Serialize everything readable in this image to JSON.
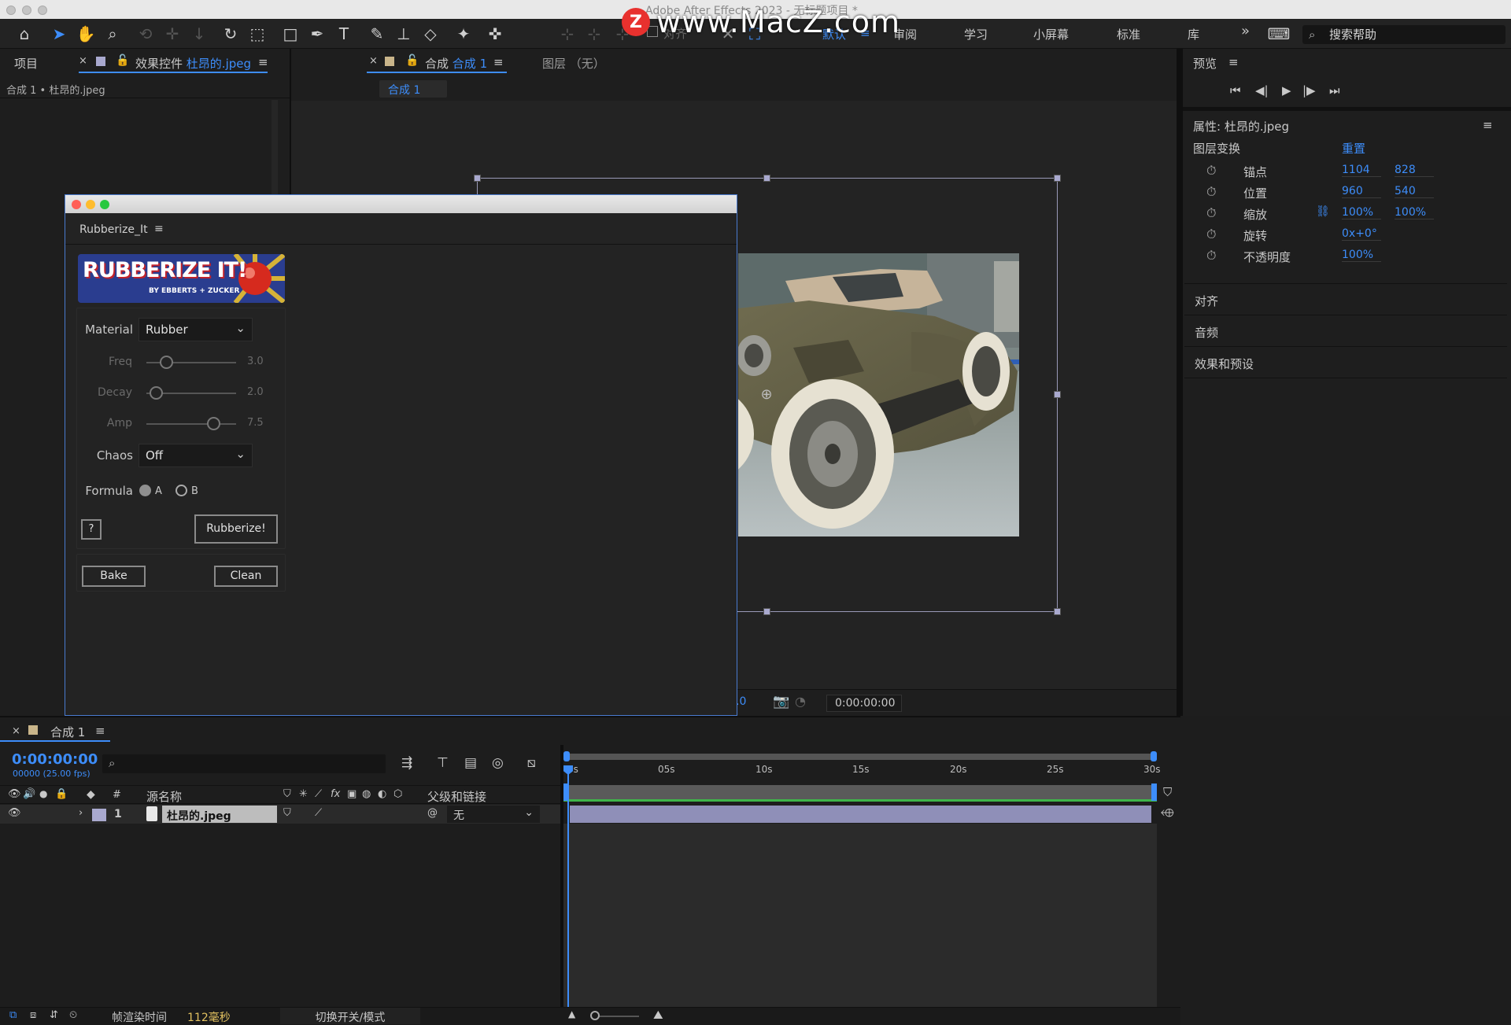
{
  "window": {
    "title": "Adobe After Effects 2023 - 无标题项目 *"
  },
  "watermark": {
    "logo": "Z",
    "text": "www.MacZ.com"
  },
  "toolbar": {
    "align_label": "对齐",
    "workspaces": [
      "默认",
      "审阅",
      "学习",
      "小屏幕",
      "标准",
      "库"
    ],
    "more_label": "»",
    "search_placeholder": "搜索帮助"
  },
  "left_panel": {
    "tab_project": "项目",
    "tab_effects_prefix": "效果控件",
    "tab_effects_layer": "杜昂的.jpeg",
    "breadcrumb": "合成 1 • 杜昂的.jpeg"
  },
  "comp_panel": {
    "tab_prefix": "合成",
    "tab_name": "合成 1",
    "tab_layer": "图层 （无）",
    "subtab": "合成 1",
    "footer_zoom": ".0",
    "footer_time": "0:00:00:00"
  },
  "plugin": {
    "panel_title": "Rubberize_It",
    "logo_main": "RUBBERIZE IT!",
    "logo_sub": "BY EBBERTS + ZUCKER",
    "material_label": "Material",
    "material_value": "Rubber",
    "sliders": [
      {
        "label": "Freq",
        "value": "3.0",
        "fraction": 0.3
      },
      {
        "label": "Decay",
        "value": "2.0",
        "fraction": 0.18
      },
      {
        "label": "Amp",
        "value": "7.5",
        "fraction": 0.82
      }
    ],
    "chaos_label": "Chaos",
    "chaos_value": "Off",
    "formula_label": "Formula",
    "formula_a": "A",
    "formula_b": "B",
    "help_label": "?",
    "rubberize_label": "Rubberize!",
    "bake_label": "Bake",
    "clean_label": "Clean"
  },
  "right_panel": {
    "preview_title": "预览",
    "properties_title": "属性: 杜昂的.jpeg",
    "transform_title": "图层变换",
    "reset_label": "重置",
    "properties": [
      {
        "name": "锚点",
        "v1": "1104",
        "v2": "828"
      },
      {
        "name": "位置",
        "v1": "960",
        "v2": "540"
      },
      {
        "name": "缩放",
        "v1": "100%",
        "v2": "100%"
      },
      {
        "name": "旋转",
        "v1": "0x+0°",
        "v2": ""
      },
      {
        "name": "不透明度",
        "v1": "100%",
        "v2": ""
      }
    ],
    "sections": [
      "对齐",
      "音频",
      "效果和预设"
    ]
  },
  "timeline": {
    "tab_name": "合成 1",
    "timecode": "0:00:00:00",
    "frames": "00000 (25.00 fps)",
    "ruler": [
      "0s",
      "05s",
      "10s",
      "15s",
      "20s",
      "25s",
      "30s"
    ],
    "col_hash": "#",
    "col_source": "源名称",
    "col_fx": "fx",
    "col_parent": "父级和链接",
    "layer_index": "1",
    "layer_name": "杜昂的.jpeg",
    "parent_value": "无"
  },
  "statusbar": {
    "render_label": "帧渲染时间",
    "render_value": "112毫秒",
    "toggle_label": "切换开关/模式"
  },
  "colors": {
    "accent": "#3d8dfa",
    "layer_bar": "#8f8fb8",
    "work_area": "#3fb54a"
  }
}
